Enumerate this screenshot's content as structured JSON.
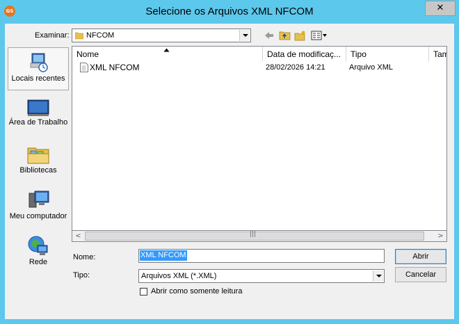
{
  "window": {
    "title": "Selecione os Arquivos XML NFCOM",
    "app_icon_text": "GS",
    "close_glyph": "✕"
  },
  "toolbar": {
    "look_in_label": "Examinar:",
    "look_in_value": "NFCOM",
    "back_icon": "back-arrow-icon",
    "up_icon": "up-folder-icon",
    "new_folder_icon": "new-folder-icon",
    "view_menu_icon": "view-menu-icon"
  },
  "places": [
    {
      "label": "Locais recentes",
      "icon": "recent-places-icon",
      "selected": true
    },
    {
      "label": "Área de Trabalho",
      "icon": "desktop-icon"
    },
    {
      "label": "Bibliotecas",
      "icon": "libraries-icon"
    },
    {
      "label": "Meu computador",
      "icon": "computer-icon"
    },
    {
      "label": "Rede",
      "icon": "network-icon"
    }
  ],
  "filelist": {
    "columns": [
      "Nome",
      "Data de modificaç...",
      "Tipo",
      "Tam"
    ],
    "rows": [
      {
        "name": "XML NFCOM",
        "modified": "28/02/2026 14:21",
        "type": "Arquivo XML"
      }
    ]
  },
  "scrollbar": {
    "left": "<",
    "right": ">",
    "grip": "|||"
  },
  "form": {
    "name_label": "Nome:",
    "name_value": "XML NFCOM",
    "type_label": "Tipo:",
    "type_value": "Arquivos XML (*.XML)",
    "readonly_label": "Abrir como somente leitura"
  },
  "buttons": {
    "open": "Abrir",
    "cancel": "Cancelar"
  },
  "colors": {
    "titlebar": "#5cc8ec",
    "selection": "#3399ff"
  }
}
